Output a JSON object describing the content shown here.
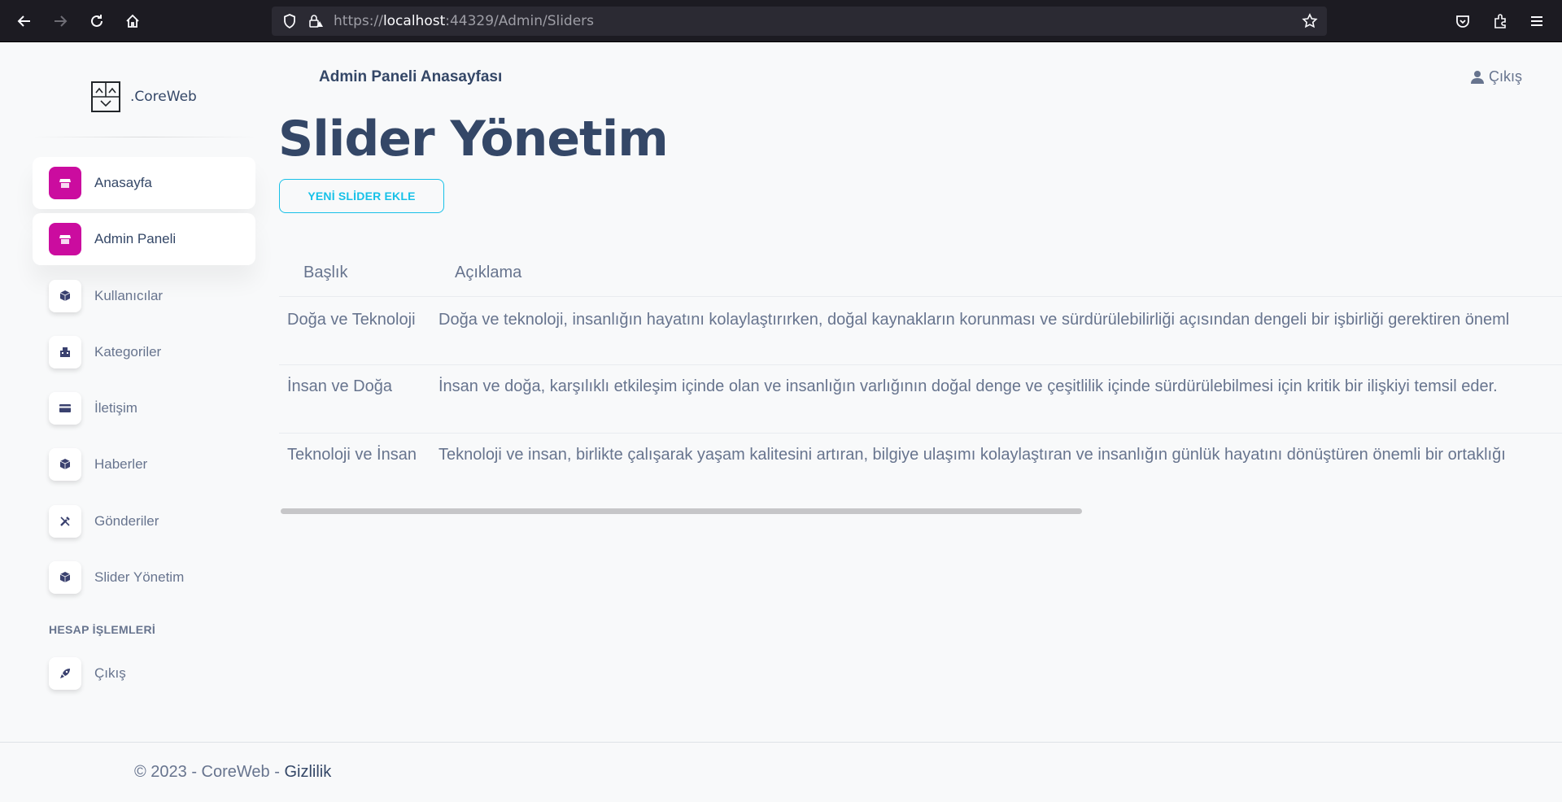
{
  "browser": {
    "url_prefix": "https://",
    "url_host": "localhost",
    "url_rest": ":44329/Admin/Sliders"
  },
  "brand": {
    "name": ".CoreWeb"
  },
  "sidebar": {
    "items": [
      {
        "label": "Anasayfa",
        "icon": "shop-icon",
        "active": true
      },
      {
        "label": "Admin Paneli",
        "icon": "shop-icon",
        "active": true
      },
      {
        "label": "Kullanıcılar",
        "icon": "box-icon",
        "active": false
      },
      {
        "label": "Kategoriler",
        "icon": "office-icon",
        "active": false
      },
      {
        "label": "İletişim",
        "icon": "credit-card-icon",
        "active": false
      },
      {
        "label": "Haberler",
        "icon": "box-icon",
        "active": false
      },
      {
        "label": "Gönderiler",
        "icon": "settings-tools-icon",
        "active": false
      },
      {
        "label": "Slider Yönetim",
        "icon": "box-icon",
        "active": false
      }
    ],
    "section_title": "HESAP İŞLEMLERİ",
    "account_items": [
      {
        "label": "Çıkış",
        "icon": "rocket-icon"
      }
    ]
  },
  "header": {
    "title": "Admin Paneli Anasayfası",
    "logout_label": "Çıkış"
  },
  "main": {
    "page_title": "Slider Yönetim",
    "add_button": "YENİ SLİDER EKLE",
    "table": {
      "columns": [
        "Başlık",
        "Açıklama"
      ],
      "rows": [
        {
          "title": "Doğa ve Teknoloji",
          "description": "Doğa ve teknoloji, insanlığın hayatını kolaylaştırırken, doğal kaynakların korunması ve sürdürülebilirliği açısından dengeli bir işbirliği gerektiren öneml"
        },
        {
          "title": "İnsan ve Doğa",
          "description": "İnsan ve doğa, karşılıklı etkileşim içinde olan ve insanlığın varlığının doğal denge ve çeşitlilik içinde sürdürülebilmesi için kritik bir ilişkiyi temsil eder."
        },
        {
          "title": "Teknoloji ve İnsan",
          "description": "Teknoloji ve insan, birlikte çalışarak yaşam kalitesini artıran, bilgiye ulaşımı kolaylaştıran ve insanlığın günlük hayatını dönüştüren önemli bir ortaklığı"
        }
      ]
    }
  },
  "footer": {
    "copyright": "© 2023 - CoreWeb - ",
    "privacy_link": "Gizlilik"
  },
  "colors": {
    "accent": "#cb0c9f",
    "info": "#17c1e8",
    "text_dark": "#344767",
    "text_muted": "#67748e"
  }
}
